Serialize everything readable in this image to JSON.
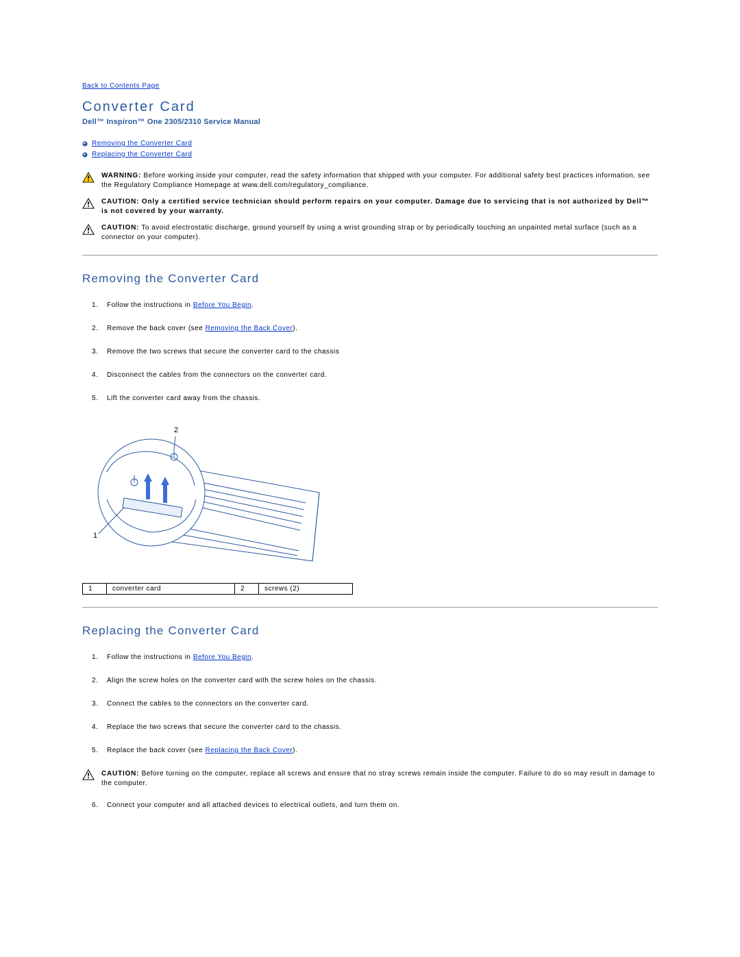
{
  "nav": {
    "back_link": "Back to Contents Page"
  },
  "header": {
    "title": "Converter Card",
    "subtitle": "Dell™ Inspiron™ One 2305/2310 Service Manual"
  },
  "toc": [
    {
      "label": "Removing the Converter Card"
    },
    {
      "label": "Replacing the Converter Card"
    }
  ],
  "notices": {
    "warning_label": "WARNING:",
    "warning_text": " Before working inside your computer, read the safety information that shipped with your computer. For additional safety best practices information, see the Regulatory Compliance Homepage at www.dell.com/regulatory_compliance.",
    "caution1_label": "CAUTION:",
    "caution1_bold": " Only a certified service technician should perform repairs on your computer. Damage due to servicing that is not authorized by Dell™ is not covered by your warranty.",
    "caution2_label": "CAUTION:",
    "caution2_text": " To avoid electrostatic discharge, ground yourself by using a wrist grounding strap or by periodically touching an unpainted metal surface (such as a connector on your computer)."
  },
  "section_remove": {
    "heading": "Removing the Converter Card",
    "steps": {
      "s1_pre": "Follow the instructions in ",
      "s1_link": "Before You Begin",
      "s1_post": ".",
      "s2_pre": "Remove the back cover (see ",
      "s2_link": "Removing the Back Cover",
      "s2_post": ").",
      "s3": "Remove the two screws that secure the converter card to the chassis",
      "s4": "Disconnect the cables from the connectors on the converter card.",
      "s5": "Lift the converter card away from the chassis."
    },
    "legend": {
      "c1_num": "1",
      "c1_label": "converter card",
      "c2_num": "2",
      "c2_label": "screws (2)"
    }
  },
  "section_replace": {
    "heading": "Replacing the Converter Card",
    "steps": {
      "s1_pre": "Follow the instructions in ",
      "s1_link": "Before You Begin",
      "s1_post": ".",
      "s2": "Align the screw holes on the converter card with the screw holes on the chassis.",
      "s3": "Connect the cables to the connectors on the converter card.",
      "s4": "Replace the two screws that secure the converter card to the chassis.",
      "s5_pre": "Replace the back cover (see ",
      "s5_link": "Replacing the Back Cover",
      "s5_post": ").",
      "s6": "Connect your computer and all attached devices to electrical outlets, and turn them on."
    },
    "caution_label": "CAUTION:",
    "caution_text": " Before turning on the computer, replace all screws and ensure that no stray screws remain inside the computer. Failure to do so may result in damage to the computer."
  }
}
